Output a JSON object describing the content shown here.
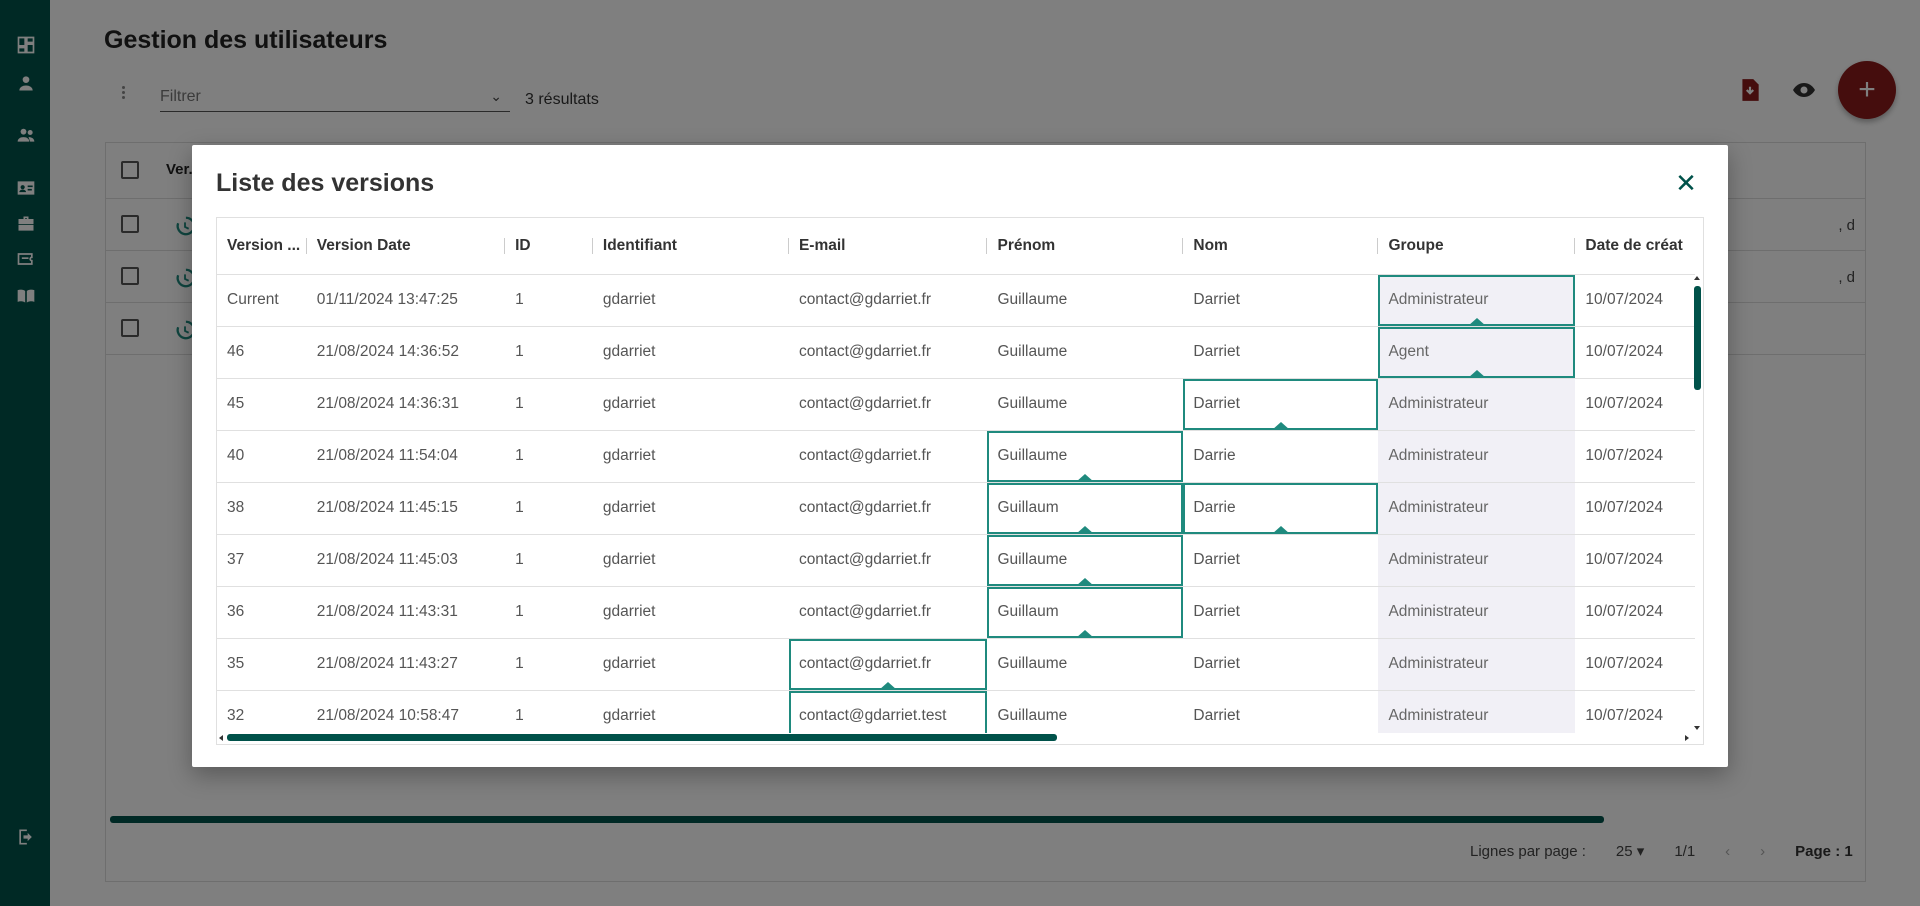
{
  "colors": {
    "sidebar": "#00524a",
    "accent": "#1f8a7e",
    "add_button": "#8b1a1a",
    "group_cell_bg": "#f1f0f6"
  },
  "sidebar": {
    "icons": [
      "dashboard-icon",
      "person-icon",
      "group-icon",
      "id-card-icon",
      "briefcase-icon",
      "ticket-icon",
      "book-icon",
      "logout-icon"
    ]
  },
  "page": {
    "title": "Gestion des utilisateurs",
    "filter_placeholder": "Filtrer",
    "results": "3 résultats",
    "table_header_first": "Ver...",
    "row_right_text": ", d",
    "footer": {
      "rows_per_page_label": "Lignes par page :",
      "rows_per_page_value": "25",
      "pages": "1/1",
      "page_label": "Page : 1"
    }
  },
  "modal": {
    "title": "Liste des versions",
    "columns": [
      "Version ...",
      "Version Date",
      "ID",
      "Identifiant",
      "E-mail",
      "Prénom",
      "Nom",
      "Groupe",
      "Date de créat"
    ],
    "rows": [
      {
        "version": "Current",
        "date": "01/11/2024 13:47:25",
        "id": "1",
        "login": "gdarriet",
        "email": "contact@gdarriet.fr",
        "firstname": "Guillaume",
        "lastname": "Darriet",
        "group": "Administrateur",
        "created": "10/07/2024",
        "diff": [
          "group"
        ]
      },
      {
        "version": "46",
        "date": "21/08/2024 14:36:52",
        "id": "1",
        "login": "gdarriet",
        "email": "contact@gdarriet.fr",
        "firstname": "Guillaume",
        "lastname": "Darriet",
        "group": "Agent",
        "created": "10/07/2024",
        "diff": [
          "group"
        ]
      },
      {
        "version": "45",
        "date": "21/08/2024 14:36:31",
        "id": "1",
        "login": "gdarriet",
        "email": "contact@gdarriet.fr",
        "firstname": "Guillaume",
        "lastname": "Darriet",
        "group": "Administrateur",
        "created": "10/07/2024",
        "diff": [
          "lastname"
        ]
      },
      {
        "version": "40",
        "date": "21/08/2024 11:54:04",
        "id": "1",
        "login": "gdarriet",
        "email": "contact@gdarriet.fr",
        "firstname": "Guillaume",
        "lastname": "Darrie",
        "group": "Administrateur",
        "created": "10/07/2024",
        "diff": [
          "firstname"
        ]
      },
      {
        "version": "38",
        "date": "21/08/2024 11:45:15",
        "id": "1",
        "login": "gdarriet",
        "email": "contact@gdarriet.fr",
        "firstname": "Guillaum",
        "lastname": "Darrie",
        "group": "Administrateur",
        "created": "10/07/2024",
        "diff": [
          "firstname",
          "lastname"
        ]
      },
      {
        "version": "37",
        "date": "21/08/2024 11:45:03",
        "id": "1",
        "login": "gdarriet",
        "email": "contact@gdarriet.fr",
        "firstname": "Guillaume",
        "lastname": "Darriet",
        "group": "Administrateur",
        "created": "10/07/2024",
        "diff": [
          "firstname"
        ]
      },
      {
        "version": "36",
        "date": "21/08/2024 11:43:31",
        "id": "1",
        "login": "gdarriet",
        "email": "contact@gdarriet.fr",
        "firstname": "Guillaum",
        "lastname": "Darriet",
        "group": "Administrateur",
        "created": "10/07/2024",
        "diff": [
          "firstname"
        ]
      },
      {
        "version": "35",
        "date": "21/08/2024 11:43:27",
        "id": "1",
        "login": "gdarriet",
        "email": "contact@gdarriet.fr",
        "firstname": "Guillaume",
        "lastname": "Darriet",
        "group": "Administrateur",
        "created": "10/07/2024",
        "diff": [
          "email"
        ]
      },
      {
        "version": "32",
        "date": "21/08/2024 10:58:47",
        "id": "1",
        "login": "gdarriet",
        "email": "contact@gdarriet.test",
        "firstname": "Guillaume",
        "lastname": "Darriet",
        "group": "Administrateur",
        "created": "10/07/2024",
        "diff": [
          "email"
        ]
      }
    ]
  }
}
